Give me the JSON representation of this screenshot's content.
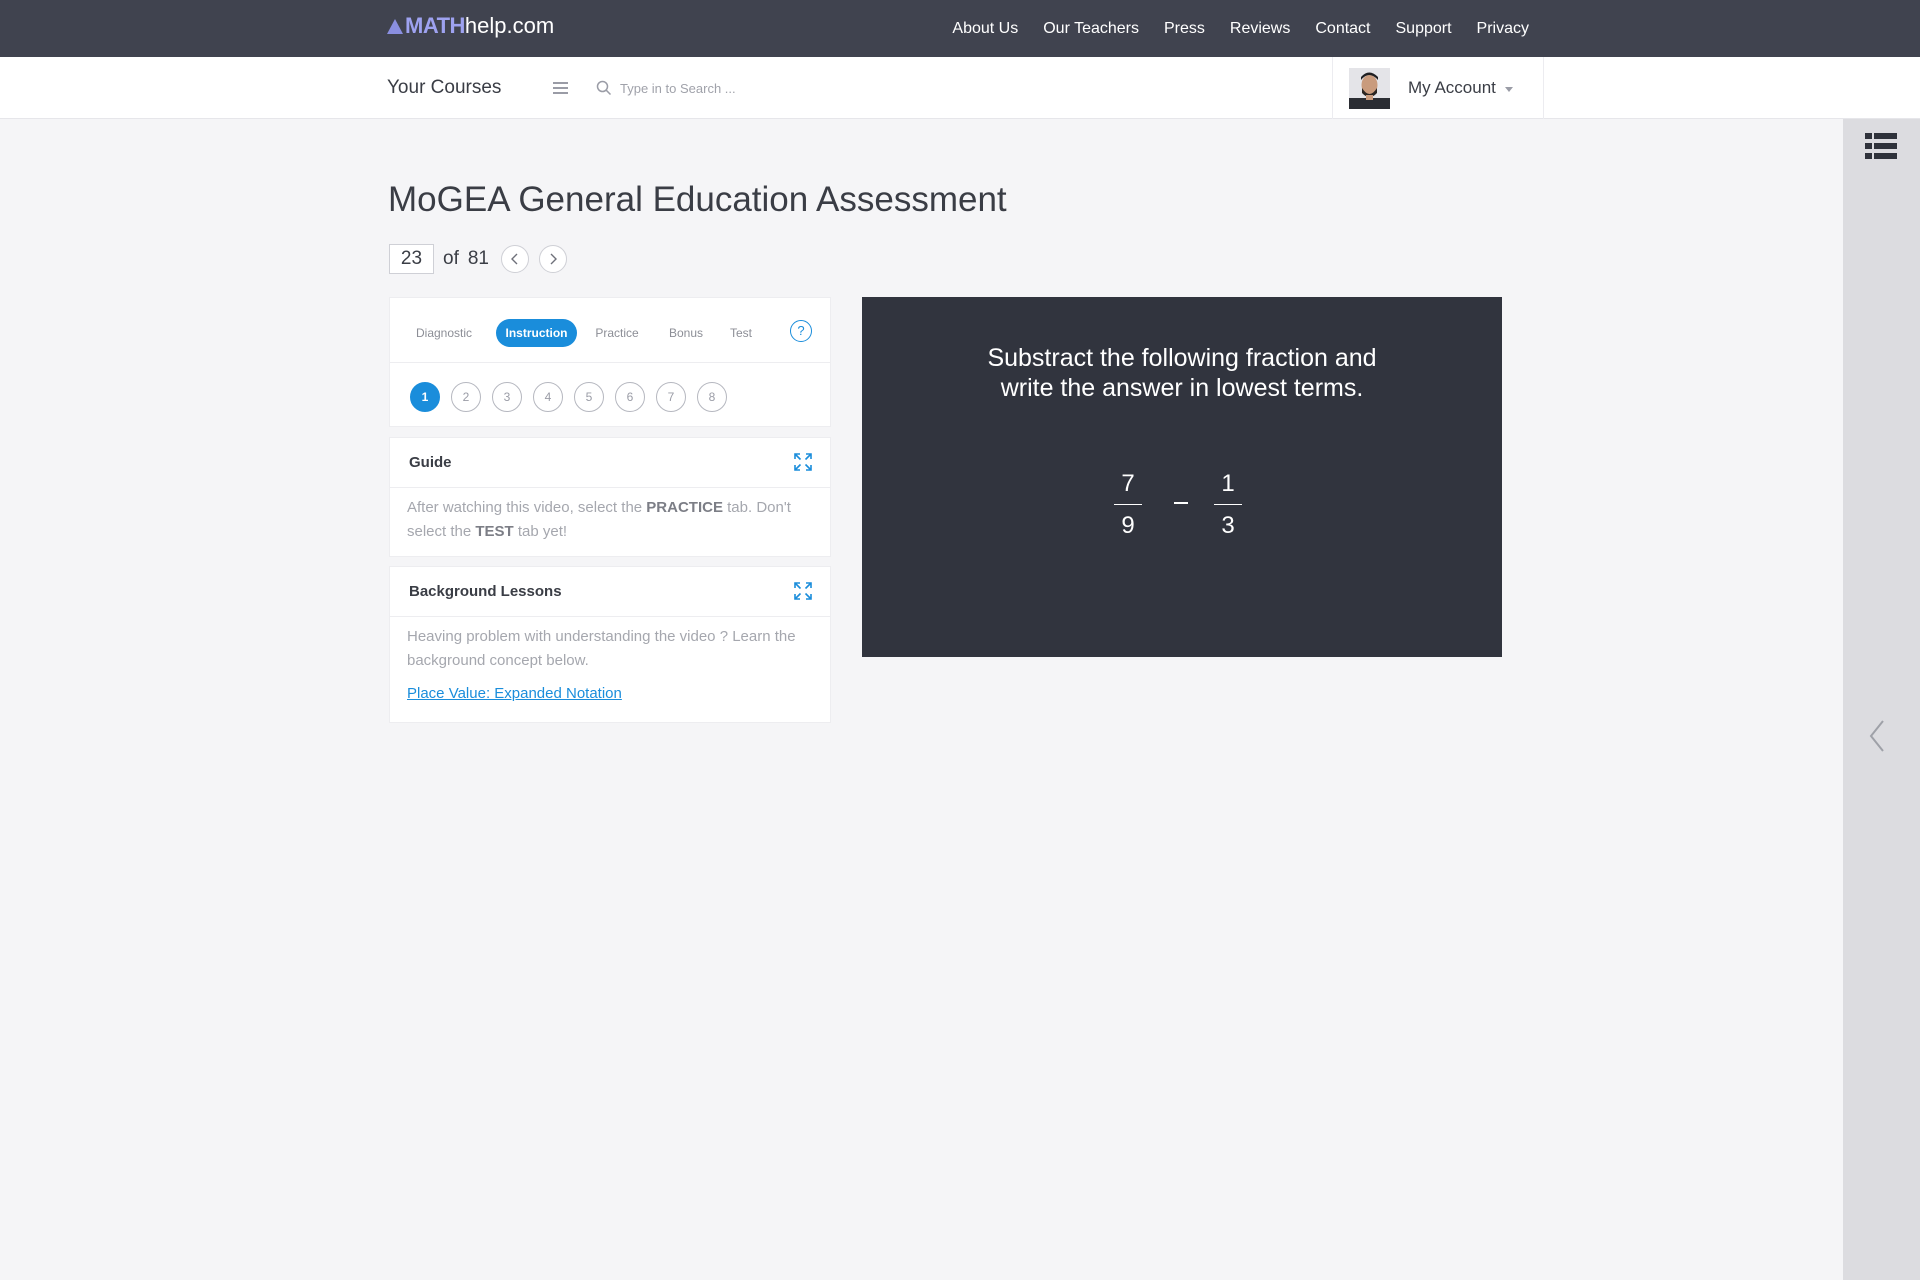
{
  "logo": {
    "math": "MATH",
    "rest": "help.com"
  },
  "topnav": [
    "About Us",
    "Our Teachers",
    "Press",
    "Reviews",
    "Contact",
    "Support",
    "Privacy"
  ],
  "subheader": {
    "your_courses": "Your Courses",
    "search_placeholder": "Type in to Search ...",
    "account_label": "My Account"
  },
  "course": {
    "title": "MoGEA General Education Assessment",
    "current_page": "23",
    "of_label": "of",
    "total_pages": "81"
  },
  "tabs": [
    {
      "label": "Diagnostic",
      "active": false
    },
    {
      "label": "Instruction",
      "active": true
    },
    {
      "label": "Practice",
      "active": false
    },
    {
      "label": "Bonus",
      "active": false
    },
    {
      "label": "Test",
      "active": false
    }
  ],
  "help_label": "?",
  "steps": [
    "1",
    "2",
    "3",
    "4",
    "5",
    "6",
    "7",
    "8"
  ],
  "active_step": "1",
  "guide": {
    "title": "Guide",
    "text_1": "After watching this video, select the ",
    "bold_1": "PRACTICE",
    "text_2": " tab. Don't select the ",
    "bold_2": "TEST",
    "text_3": " tab yet!"
  },
  "background_lessons": {
    "title": "Background Lessons",
    "text": "Heaving problem with understanding  the video ? Learn the background  concept below.",
    "link": "Place Value: Expanded Notation"
  },
  "video": {
    "line_1": "Substract the following fraction and",
    "line_2": "write the answer in lowest terms.",
    "fraction_a": {
      "num": "7",
      "den": "9"
    },
    "fraction_b": {
      "num": "1",
      "den": "3"
    }
  },
  "colors": {
    "topbar": "#40434f",
    "accent": "#1a8ddb",
    "video_bg": "#31343e",
    "page_bg": "#f5f5f7"
  }
}
